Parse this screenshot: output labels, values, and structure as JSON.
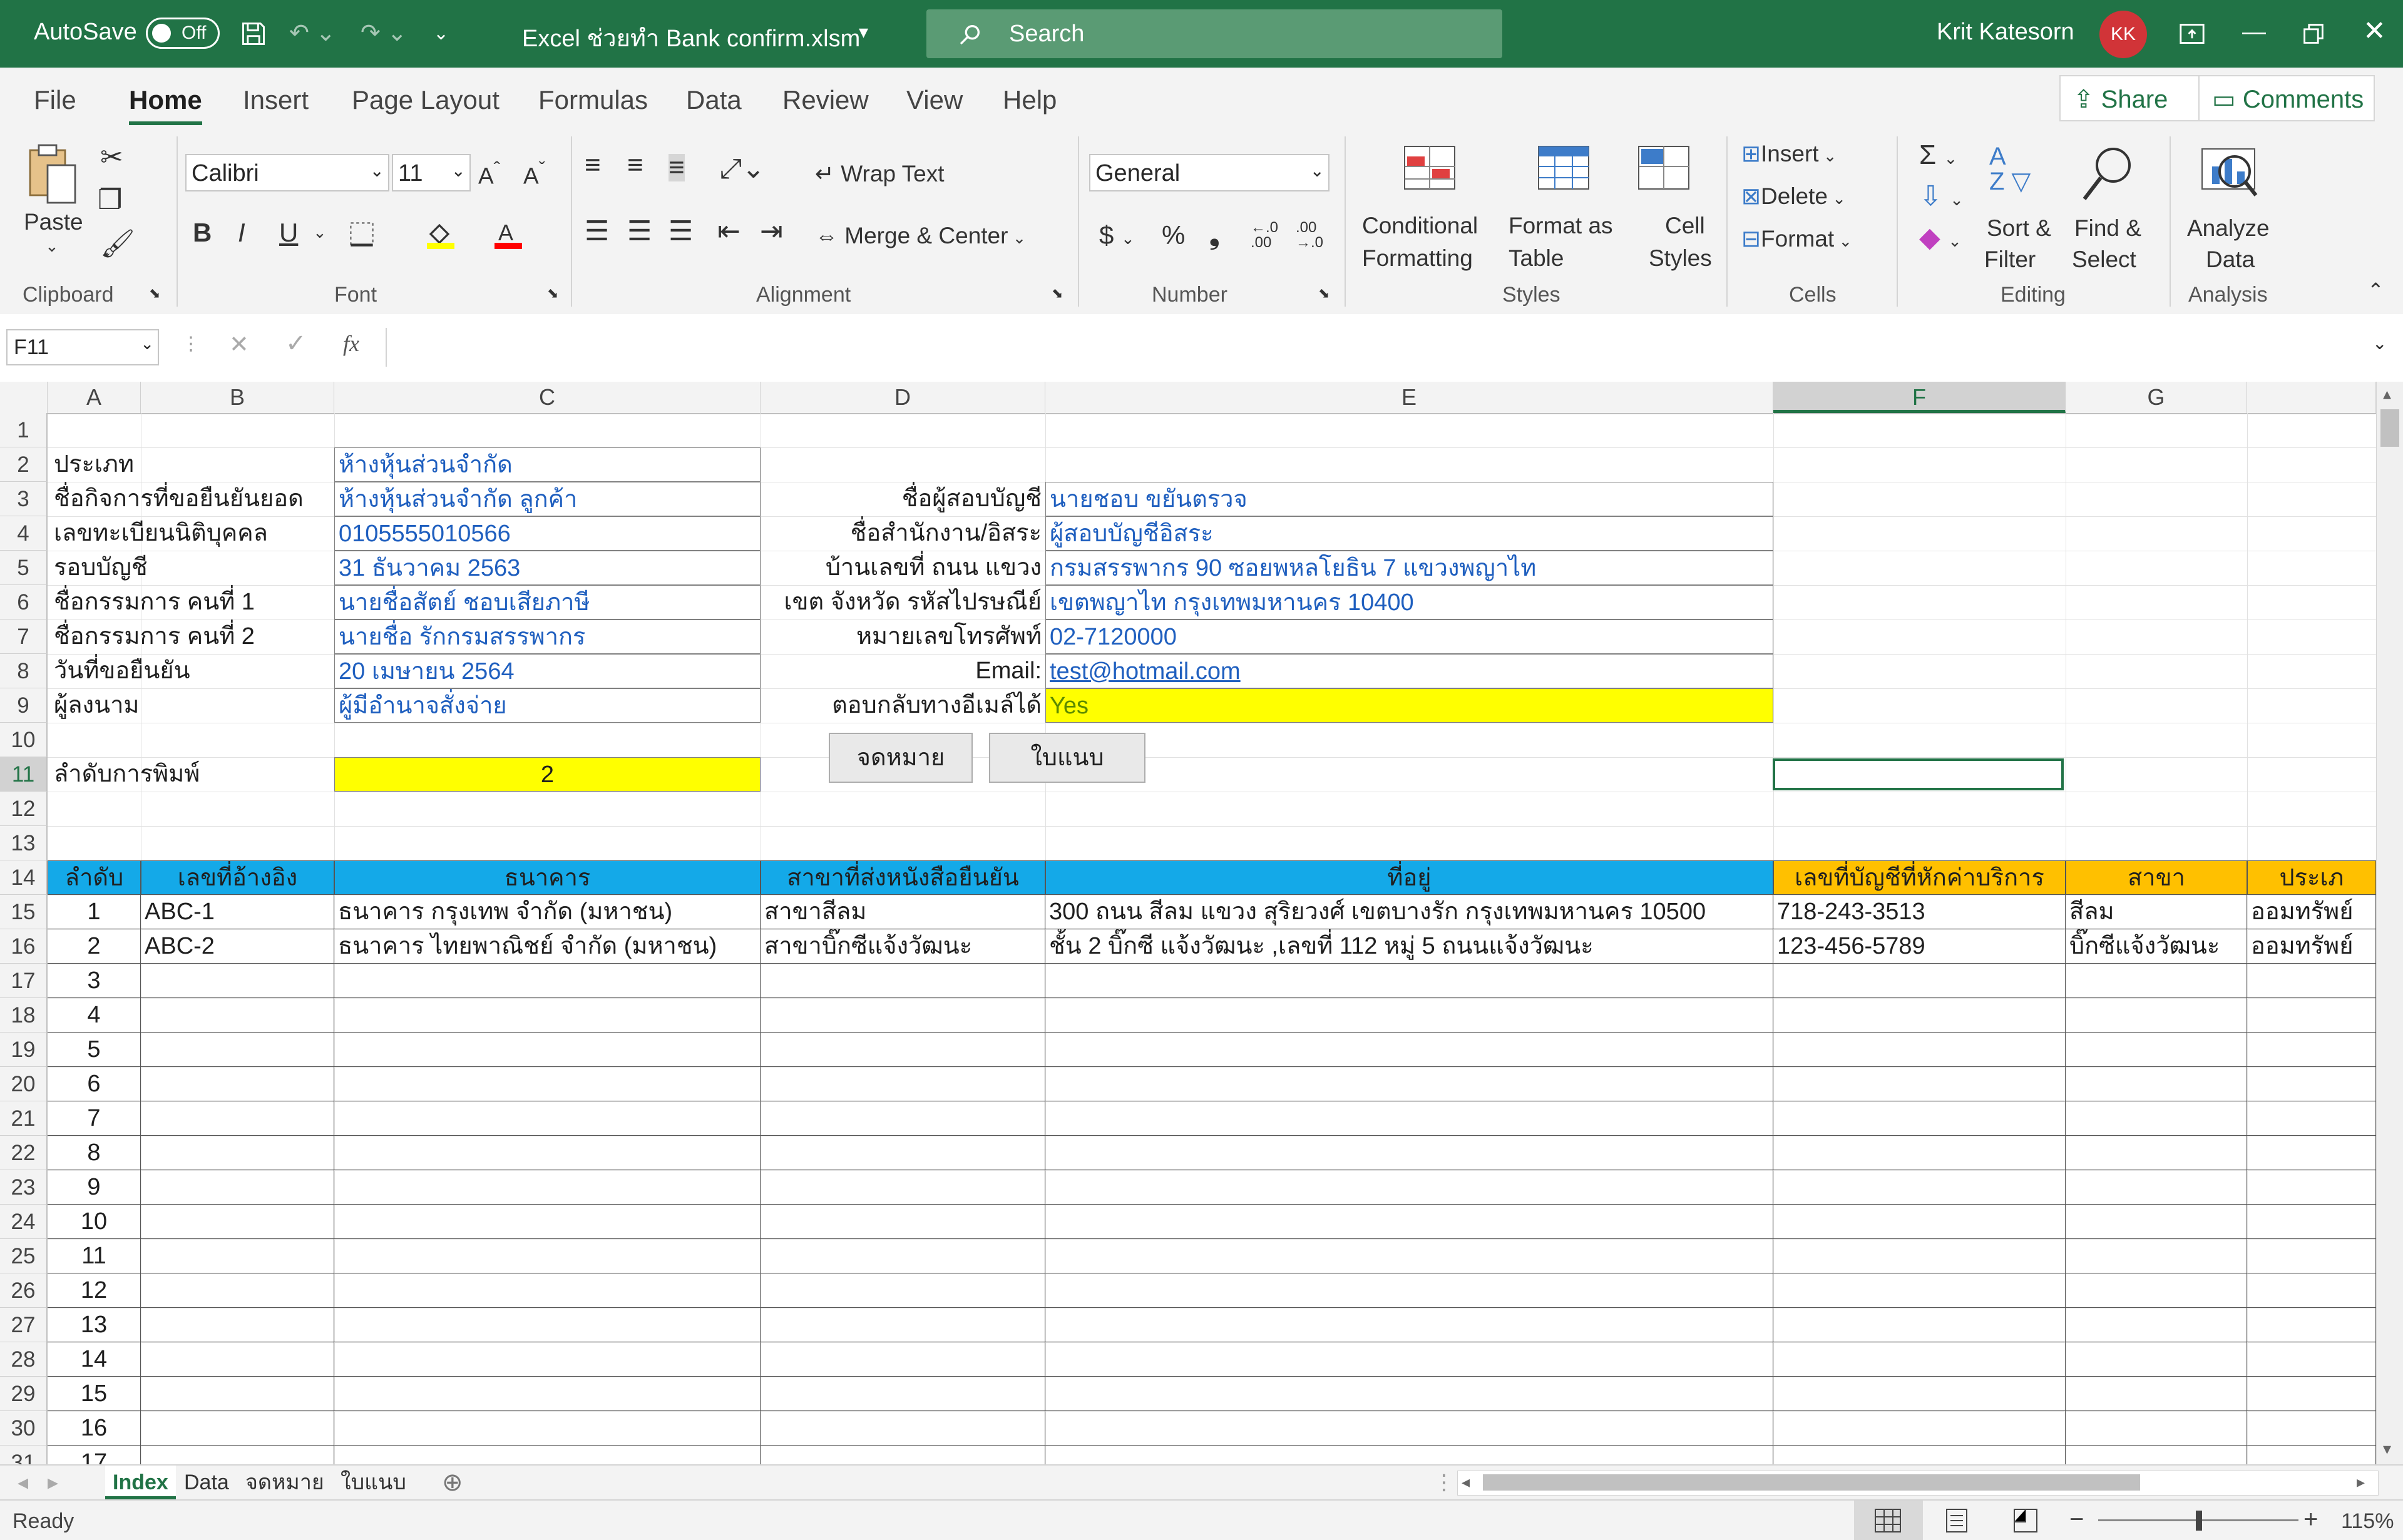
{
  "titlebar": {
    "autosave_label": "AutoSave",
    "autosave_state": "Off",
    "doc_title": "Excel ช่วยทำ Bank confirm.xlsm",
    "search_placeholder": "Search",
    "user_name": "Krit Katesorn",
    "user_initials": "KK"
  },
  "menu": {
    "tabs": [
      "File",
      "Home",
      "Insert",
      "Page Layout",
      "Formulas",
      "Data",
      "Review",
      "View",
      "Help"
    ],
    "active": "Home",
    "share": "Share",
    "comments": "Comments"
  },
  "ribbon": {
    "clipboard": {
      "paste": "Paste",
      "group": "Clipboard"
    },
    "font": {
      "name": "Calibri",
      "size": "11",
      "group": "Font"
    },
    "alignment": {
      "wrap": "Wrap Text",
      "merge": "Merge & Center",
      "group": "Alignment"
    },
    "number": {
      "format": "General",
      "group": "Number"
    },
    "styles": {
      "conditional_1": "Conditional",
      "conditional_2": "Formatting",
      "format_table_1": "Format as",
      "format_table_2": "Table",
      "cell_styles_1": "Cell",
      "cell_styles_2": "Styles",
      "group": "Styles"
    },
    "cells": {
      "insert": "Insert",
      "delete": "Delete",
      "format": "Format",
      "group": "Cells"
    },
    "editing": {
      "sort_1": "Sort &",
      "sort_2": "Filter",
      "find_1": "Find &",
      "find_2": "Select",
      "group": "Editing"
    },
    "analysis": {
      "analyze_1": "Analyze",
      "analyze_2": "Data",
      "group": "Analysis"
    }
  },
  "formula_bar": {
    "name_box": "F11",
    "fx": "fx",
    "content": ""
  },
  "columns": [
    "A",
    "B",
    "C",
    "D",
    "E",
    "F",
    "G"
  ],
  "selected_column": "F",
  "rows": [
    "1",
    "2",
    "3",
    "4",
    "5",
    "6",
    "7",
    "8",
    "9",
    "10",
    "11",
    "12",
    "13",
    "14",
    "15",
    "16",
    "17",
    "18",
    "19",
    "20",
    "21",
    "22",
    "23",
    "24",
    "25",
    "26",
    "27",
    "28",
    "29",
    "30",
    "31"
  ],
  "form_left": {
    "labels": [
      "ประเภท",
      "ชื่อกิจการที่ขอยืนยันยอด",
      "เลขทะเบียนนิติบุคคล",
      "รอบบัญชี",
      "ชื่อกรรมการ คนที่ 1",
      "ชื่อกรรมการ คนที่ 2",
      "วันที่ขอยืนยัน",
      "ผู้ลงนาม"
    ],
    "values": [
      "ห้างหุ้นส่วนจำกัด",
      "ห้างหุ้นส่วนจำกัด ลูกค้า",
      "0105555010566",
      "31 ธันวาคม 2563",
      "นายชื่อสัตย์ ชอบเสียภาษี",
      "นายชื่อ รักกรมสรรพากร",
      "20 เมษายน 2564",
      "ผู้มีอำนาจสั่งจ่าย"
    ]
  },
  "form_right": {
    "labels": [
      "ชื่อผู้สอบบัญชี",
      "ชื่อสำนักงาน/อิสระ",
      "บ้านเลขที่ ถนน แขวง",
      "เขต จังหวัด รหัสไปรษณีย์",
      "หมายเลขโทรศัพท์",
      "Email:",
      "ตอบกลับทางอีเมล์ได้"
    ],
    "values": [
      "นายชอบ  ขยันตรวจ",
      "ผู้สอบบัญชีอิสระ",
      "กรมสรรพากร 90 ซอยพหลโยธิน 7 แขวงพญาไท",
      "เขตพญาไท กรุงเทพมหานคร 10400",
      "02-7120000",
      "test@hotmail.com",
      "Yes"
    ]
  },
  "print_order": {
    "label": "ลำดับการพิมพ์",
    "value": "2",
    "btn_letter": "จดหมาย",
    "btn_attach": "ใบแนบ"
  },
  "table": {
    "headers": [
      "ลำดับ",
      "เลขที่อ้างอิง",
      "ธนาคาร",
      "สาขาที่ส่งหนังสือยืนยัน",
      "ที่อยู่",
      "เลขที่บัญชีที่หักค่าบริการ",
      "สาขา",
      "ประเภ"
    ],
    "rows": [
      [
        "1",
        "ABC-1",
        "ธนาคาร กรุงเทพ จำกัด (มหาชน)",
        "สาขาสีลม",
        "300 ถนน สีลม แขวง สุริยวงศ์ เขตบางรัก กรุงเทพมหานคร 10500",
        "718-243-3513",
        "สีลม",
        "ออมทรัพย์"
      ],
      [
        "2",
        "ABC-2",
        "ธนาคาร ไทยพาณิชย์ จำกัด (มหาชน)",
        "สาขาบิ๊กซีแจ้งวัฒนะ",
        "ชั้น 2 บิ๊กซี แจ้งวัฒนะ ,เลขที่ 112 หมู่ 5 ถนนแจ้งวัฒนะ",
        "123-456-5789",
        "บิ๊กซีแจ้งวัฒนะ",
        "ออมทรัพย์"
      ]
    ],
    "seq": [
      "3",
      "4",
      "5",
      "6",
      "7",
      "8",
      "9",
      "10",
      "11",
      "12",
      "13",
      "14",
      "15",
      "16",
      "17"
    ]
  },
  "sheets": [
    "Index",
    "Data",
    "จดหมาย",
    "ใบแนบ"
  ],
  "active_sheet": "Index",
  "status": {
    "ready": "Ready",
    "zoom": "115%"
  },
  "colors": {
    "excel_green": "#217346",
    "yellow": "#ffff00",
    "header_blue": "#14a9e8",
    "header_orange": "#ffc000",
    "value_blue": "#1f5fbf"
  }
}
